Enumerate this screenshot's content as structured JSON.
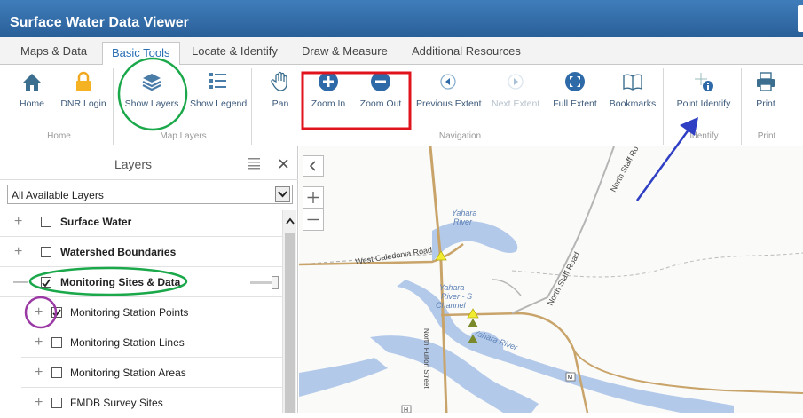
{
  "app": {
    "title": "Surface Water Data Viewer"
  },
  "tabs": [
    "Maps & Data",
    "Basic Tools",
    "Locate & Identify",
    "Draw & Measure",
    "Additional Resources"
  ],
  "ribbon": {
    "groups": {
      "home": "Home",
      "map_layers": "Map Layers",
      "navigation": "Navigation",
      "identify": "Identify",
      "print": "Print"
    },
    "tools": {
      "home": "Home",
      "dnr_login": "DNR Login",
      "show_layers": "Show Layers",
      "show_legend": "Show Legend",
      "pan": "Pan",
      "zoom_in": "Zoom In",
      "zoom_out": "Zoom Out",
      "previous_extent": "Previous Extent",
      "next_extent": "Next Extent",
      "full_extent": "Full Extent",
      "bookmarks": "Bookmarks",
      "point_identify": "Point Identify",
      "print": "Print"
    }
  },
  "layers_panel": {
    "title": "Layers",
    "select_value": "All Available Layers",
    "items": [
      {
        "label": "Surface Water",
        "checked": false,
        "expand": "+"
      },
      {
        "label": "Watershed Boundaries",
        "checked": false,
        "expand": "+"
      },
      {
        "label": "Monitoring Sites & Data",
        "checked": true,
        "expand": "—"
      },
      {
        "label": "Monitoring Station Points",
        "checked": true,
        "expand": "+"
      },
      {
        "label": "Monitoring Station Lines",
        "checked": false,
        "expand": "+"
      },
      {
        "label": "Monitoring Station Areas",
        "checked": false,
        "expand": "+"
      },
      {
        "label": "FMDB Survey Sites",
        "checked": false,
        "expand": "+"
      }
    ]
  },
  "map": {
    "labels": {
      "yahara_river_1": "Yahara",
      "yahara_river_2": "River",
      "west_caledonia": "West Caledonia Road",
      "north_staff_road_1": "North Staff Ro",
      "north_staff_road_2": "North Staff Road",
      "yahara_channel_1": "Yahara",
      "yahara_channel_2": "River - S",
      "yahara_channel_3": "Channel",
      "yahara_river_3": "Yahara River",
      "north_fulton": "North Fulton Street",
      "shield_m": "M",
      "shield_h": "H"
    }
  },
  "colors": {
    "title_bar": "#2f6aa8",
    "highlight_red": "#e0141c",
    "highlight_green": "#1aa84a",
    "highlight_purple": "#9b3aa5",
    "arrow_blue": "#2f3fc4",
    "water": "#b3c9ea",
    "road": "#c9a46a"
  }
}
